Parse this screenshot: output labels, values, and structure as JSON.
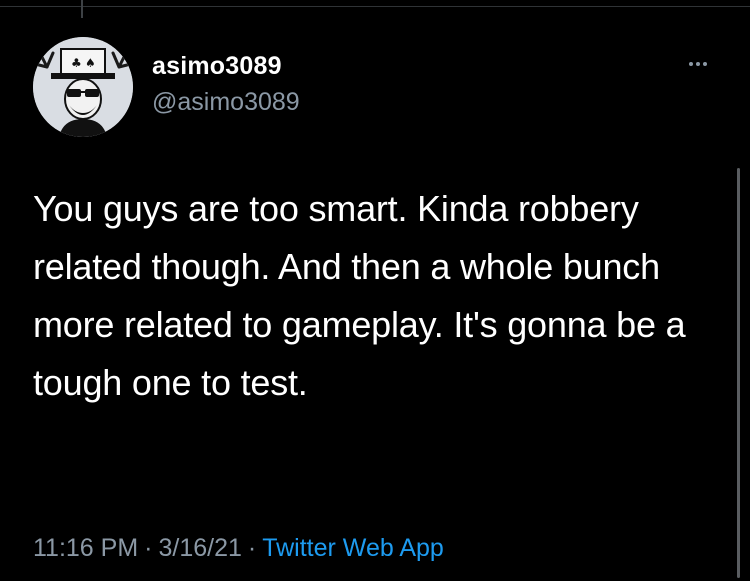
{
  "tweet": {
    "author": {
      "display_name": "asimo3089",
      "handle": "@asimo3089",
      "avatar_icon": "avatar-top-hat-sunglasses"
    },
    "text": "You guys are too smart. Kinda robbery related though. And then a whole bunch more related to gameplay. It's gonna be a tough one to test.",
    "time": "11:16 PM",
    "separator": "·",
    "date": "3/16/21",
    "source": "Twitter Web App"
  },
  "colors": {
    "background": "#000000",
    "primary_text": "#ffffff",
    "secondary_text": "#8b98a5",
    "link": "#1d9bf0"
  }
}
